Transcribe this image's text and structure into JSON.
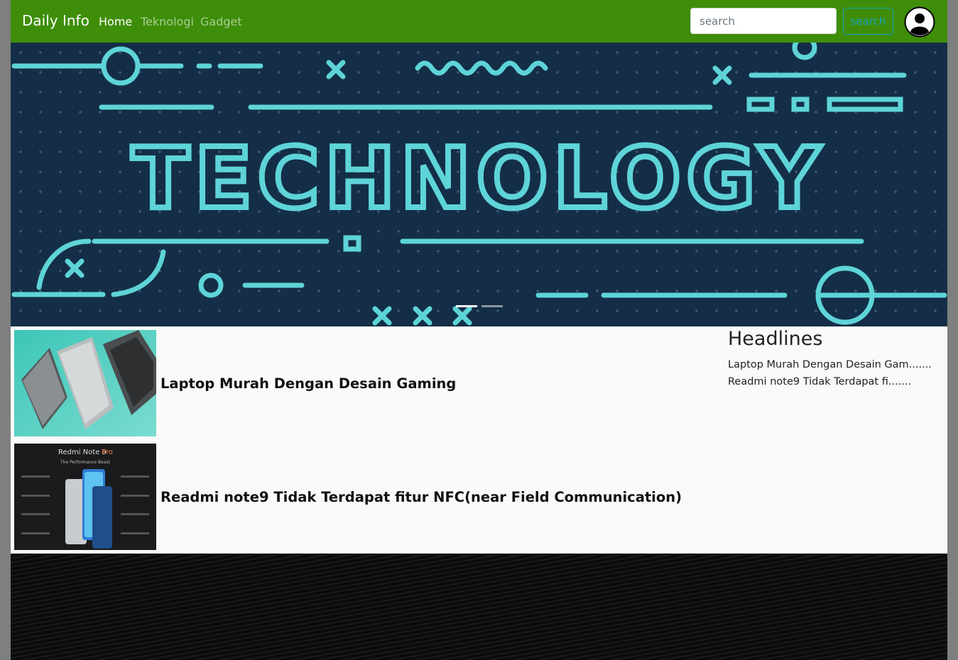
{
  "navbar": {
    "brand": "Daily Info",
    "links": [
      {
        "label": "Home",
        "active": true
      },
      {
        "label": "Teknologi",
        "active": false
      },
      {
        "label": "Gadget",
        "active": false
      }
    ],
    "search": {
      "placeholder": "search",
      "button_label": "search"
    },
    "color": "#3e8e09"
  },
  "hero": {
    "text": "TECHNOLOGY",
    "background_color": "#142e47",
    "accent_color": "#5ed4d8",
    "slides": 2,
    "active_slide": 1
  },
  "articles": [
    {
      "title": "Laptop Murah Dengan Desain Gaming",
      "thumb_icon": "laptop-image"
    },
    {
      "title": "Readmi note9 Tidak Terdapat fitur NFC(near Field Communication)",
      "thumb_icon": "phone-image",
      "thumb_text": {
        "heading_a": "Redmi Note 9",
        "heading_b": "Pro",
        "subheading": "The Performance Beast"
      }
    }
  ],
  "headlines": {
    "title": "Headlines",
    "items": [
      "Laptop Murah Dengan Desain Gam.......",
      "Readmi note9 Tidak Terdapat fi......."
    ]
  }
}
